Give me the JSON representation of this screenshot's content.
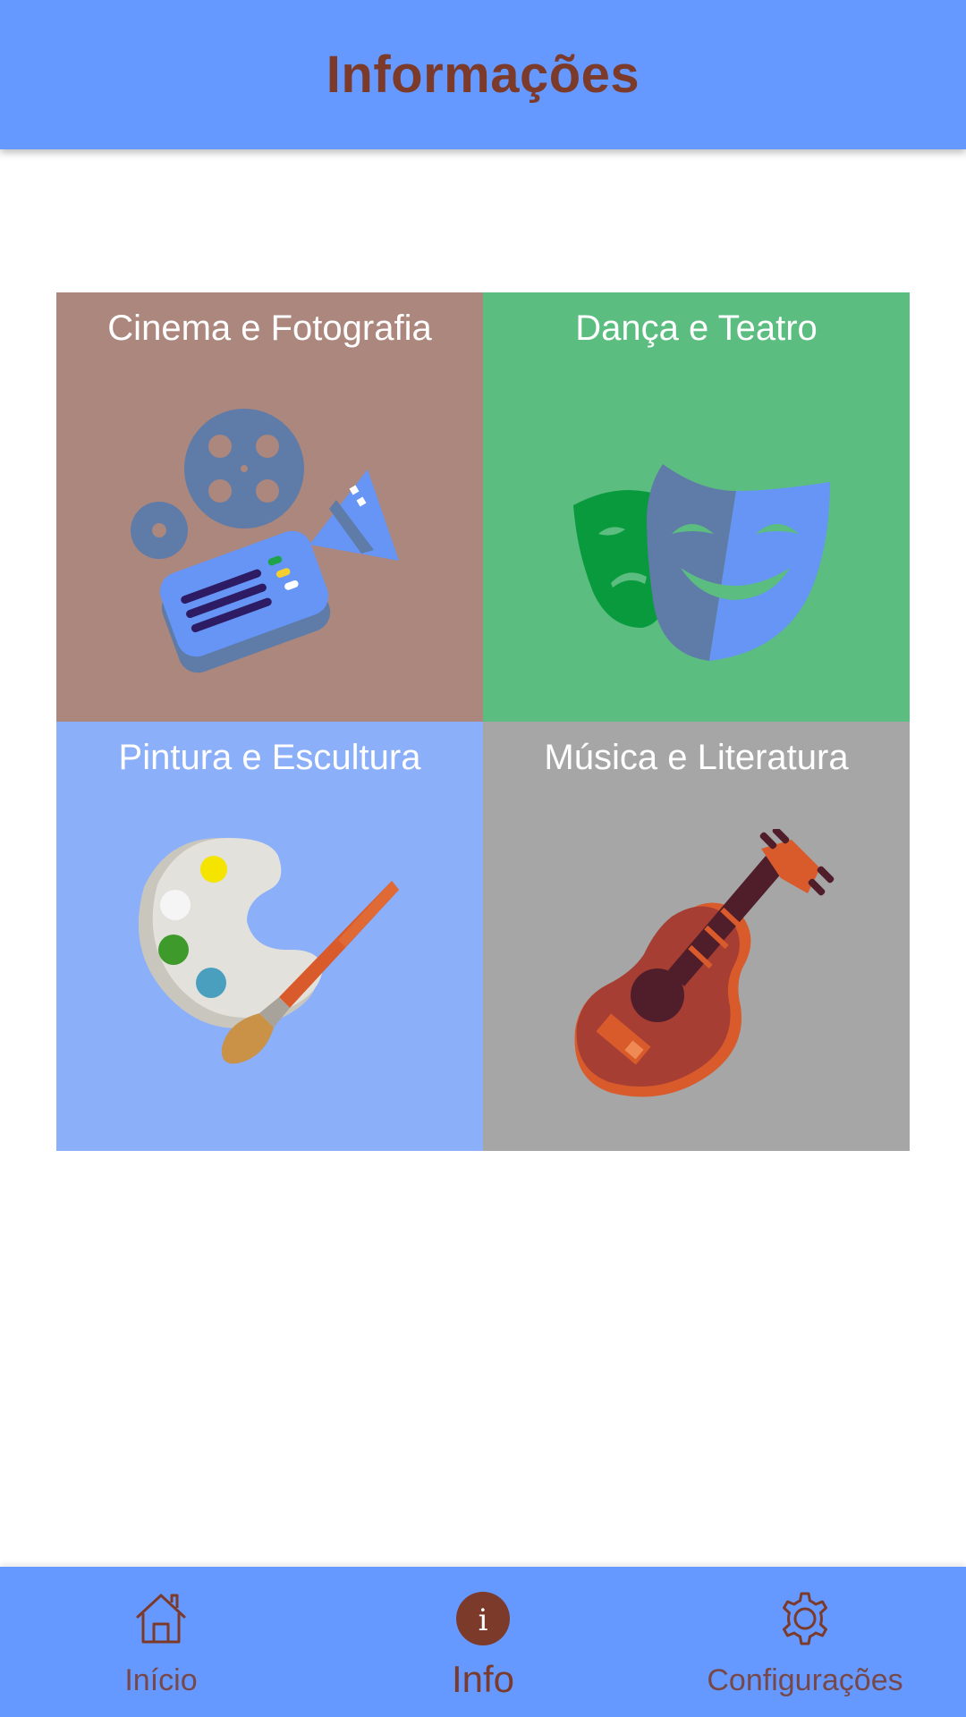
{
  "header": {
    "title": "Informações"
  },
  "categories": [
    {
      "label": "Cinema e Fotografia",
      "bg_color": "#AC877D",
      "icon": "film-camera-icon"
    },
    {
      "label": "Dança e Teatro",
      "bg_color": "#5BBD7F",
      "icon": "theater-masks-icon"
    },
    {
      "label": "Pintura e Escultura",
      "bg_color": "#8BAFF9",
      "icon": "paint-palette-icon"
    },
    {
      "label": "Música e Literatura",
      "bg_color": "#A6A6A6",
      "icon": "guitar-icon"
    }
  ],
  "bottom_nav": {
    "items": [
      {
        "label": "Início",
        "icon": "home-icon",
        "active": false
      },
      {
        "label": "Info",
        "icon": "info-icon",
        "active": true
      },
      {
        "label": "Configurações",
        "icon": "gear-icon",
        "active": false
      }
    ]
  },
  "colors": {
    "primary": "#6699FF",
    "accent": "#7B3A2A"
  }
}
